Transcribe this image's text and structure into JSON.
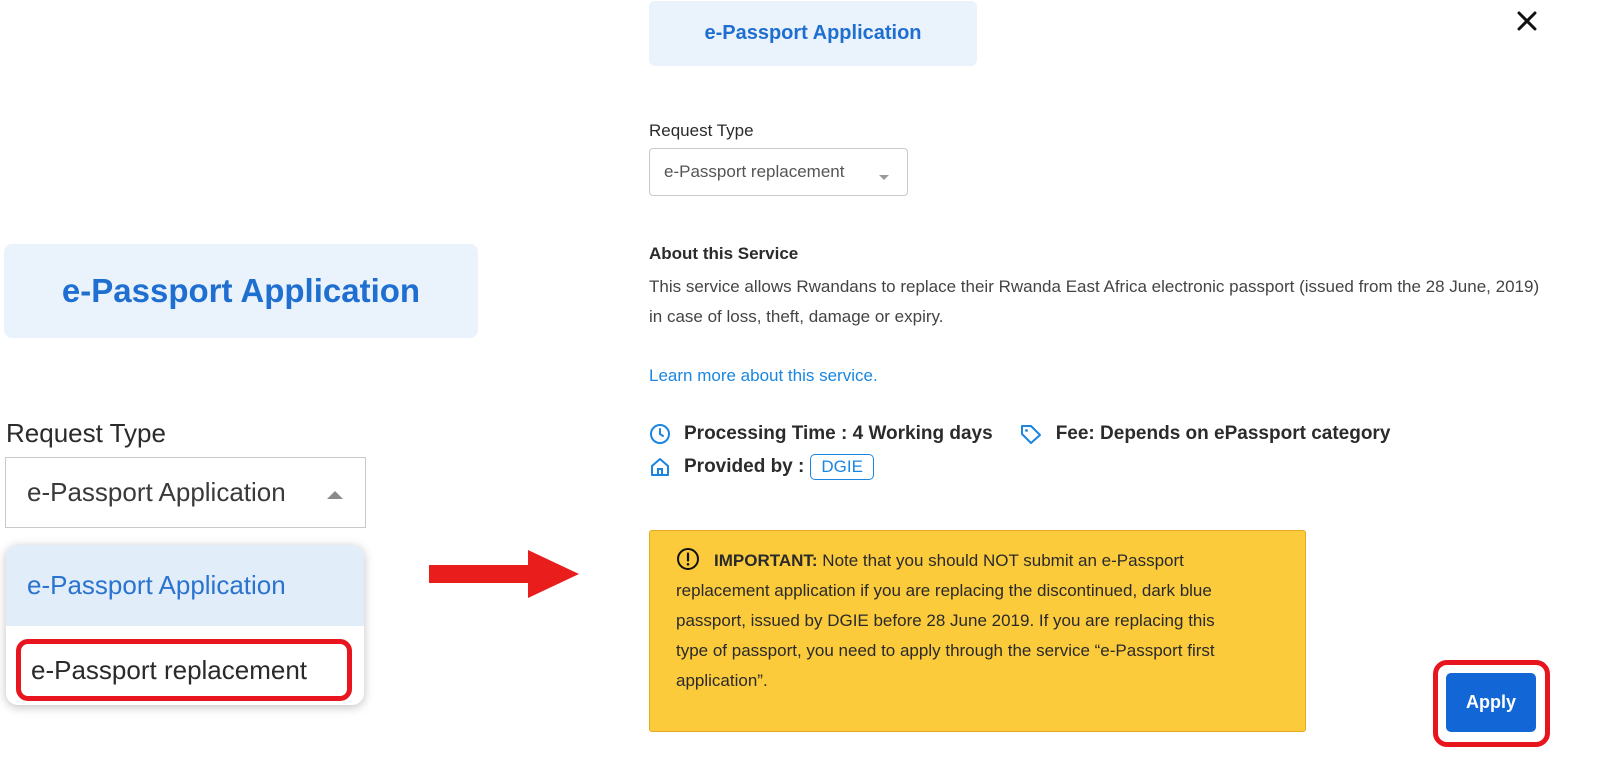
{
  "left": {
    "title": "e-Passport Application",
    "request_type_label": "Request Type",
    "select_value": "e-Passport Application",
    "dropdown_options": [
      "e-Passport Application",
      "e-Passport replacement"
    ]
  },
  "arrow": {
    "color": "#ea1d1d"
  },
  "right": {
    "title": "e-Passport Application",
    "request_type_label": "Request Type",
    "select_value": "e-Passport replacement",
    "about_heading": "About this Service",
    "about_text": "This service allows Rwandans to replace their Rwanda East Africa electronic passport (issued from the 28 June, 2019) in case of loss, theft, damage or expiry.",
    "learn_more": "Learn more about this service.",
    "processing_time": "Processing Time : 4 Working days",
    "fee": "Fee: Depends on ePassport category",
    "provided_by_label": "Provided by :",
    "provider": "DGIE",
    "important_label": "IMPORTANT:",
    "important_text": " Note that you should NOT submit an e-Passport replacement application if you are replacing the discontinued, dark blue passport, issued by DGIE before 28 June 2019. If you are replacing this type of passport, you need to apply through the service “e-Passport first application”.",
    "apply_label": "Apply"
  },
  "icons": {
    "close": "close-icon",
    "clock": "clock-icon",
    "tag": "tag-icon",
    "home": "home-icon",
    "exclamation": "exclamation-circle-icon"
  },
  "colors": {
    "accent_blue": "#1f6fd1",
    "link_blue": "#1a86e0",
    "apply_blue": "#1366d6",
    "highlight_red": "#e8141e",
    "warning_yellow": "#fbcb3b"
  }
}
